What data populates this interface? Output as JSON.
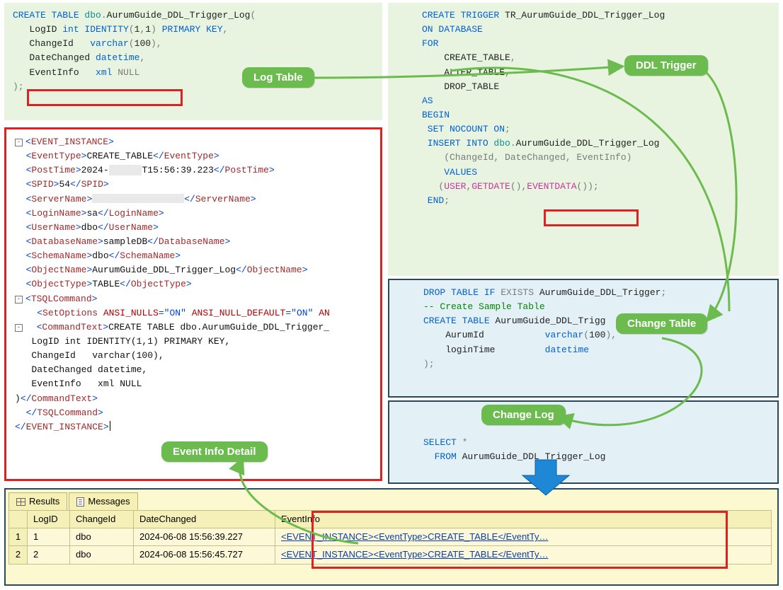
{
  "badges": {
    "log_table": "Log Table",
    "ddl_trigger": "DDL Trigger",
    "event_info_detail": "Event Info Detail",
    "change_table": "Change Table",
    "change_log": "Change Log"
  },
  "log_table_sql": {
    "l1a": "CREATE TABLE ",
    "l1b": "dbo",
    "l1c": ".",
    "l1d": "AurumGuide_DDL_Trigger_Log",
    "l1e": "(",
    "l2a": "   LogID ",
    "l2b": "int IDENTITY",
    "l2c": "(",
    "l2d": "1",
    "l2e": ",",
    "l2f": "1",
    "l2g": ")",
    "l2h": " PRIMARY KEY",
    "l2i": ",",
    "l3a": "   ChangeId   ",
    "l3b": "varchar",
    "l3c": "(",
    "l3d": "100",
    "l3e": "),",
    "l4a": "   DateChanged ",
    "l4b": "datetime",
    "l4c": ",",
    "l5a": "   EventInfo   ",
    "l5b": "xml ",
    "l5c": "NULL",
    "l6": ");"
  },
  "xml": {
    "root_open": "EVENT_INSTANCE",
    "event_type": {
      "tag": "EventType",
      "val": "CREATE_TABLE"
    },
    "post_time": {
      "tag": "PostTime",
      "pre": "2024-",
      "blur": "      ",
      "post": "T15:56:39.223"
    },
    "spid": {
      "tag": "SPID",
      "val": "54"
    },
    "server": {
      "tag": "ServerName",
      "val": ""
    },
    "login": {
      "tag": "LoginName",
      "val": "sa"
    },
    "user": {
      "tag": "UserName",
      "val": "dbo"
    },
    "db": {
      "tag": "DatabaseName",
      "val": "sampleDB"
    },
    "schema": {
      "tag": "SchemaName",
      "val": "dbo"
    },
    "obj": {
      "tag": "ObjectName",
      "val": "AurumGuide_DDL_Trigger_Log"
    },
    "otype": {
      "tag": "ObjectType",
      "val": "TABLE"
    },
    "tsql": "TSQLCommand",
    "setopt_tag": "SetOptions",
    "setopt_a1": "ANSI_NULLS",
    "setopt_v1": "ON",
    "setopt_a2": "ANSI_NULL_DEFAULT",
    "setopt_v2": "ON",
    "setopt_tail": "AN",
    "cmdtext": "CommandText",
    "cmd_l1": "CREATE TABLE dbo.AurumGuide_DDL_Trigger_",
    "cmd_l2": "   LogID int IDENTITY(1,1) PRIMARY KEY,",
    "cmd_l3": "   ChangeId   varchar(100),",
    "cmd_l4": "   DateChanged datetime,",
    "cmd_l5": "   EventInfo   xml NULL",
    "cmd_l6": ")"
  },
  "trigger_sql": {
    "t1a": "CREATE TRIGGER ",
    "t1b": "TR_AurumGuide_DDL_Trigger_Log",
    "t2": "ON DATABASE",
    "t3": "FOR",
    "t4": "    CREATE_TABLE",
    "t4c": ",",
    "t5": "    ALTER_TABLE",
    "t5c": ",",
    "t6": "    DROP_TABLE",
    "t7": "AS",
    "t8": "BEGIN",
    "t9a": " SET NOCOUNT ON",
    "t9b": ";",
    "t10a": " INSERT INTO ",
    "t10b": "dbo",
    "t10c": ".",
    "t10d": "AurumGuide_DDL_Trigger_Log",
    "t11": "    (ChangeId, DateChanged, EventInfo)",
    "t12a": "    VALUES",
    "t13a": "   (",
    "t13b": "USER",
    "t13c": ",",
    "t13d": "GETDATE",
    "t13e": "()",
    "t13f": ",",
    "t13g": "EVENTDATA",
    "t13h": "()",
    "t13i": ");",
    "t14a": " END",
    "t14b": ";"
  },
  "change_table_sql": {
    "c1a": "DROP TABLE IF ",
    "c1b": "EXISTS ",
    "c1c": "AurumGuide_DDL_Trigger",
    "c1d": ";",
    "c2": "-- Create Sample Table",
    "c3a": "CREATE TABLE ",
    "c3b": "AurumGuide_DDL_Trigg",
    "c4a": "    AurumId           ",
    "c4b": "varchar",
    "c4c": "(",
    "c4d": "100",
    "c4e": "),",
    "c5a": "    loginTime         ",
    "c5b": "datetime",
    "c6": ");"
  },
  "select_sql": {
    "s1": "SELECT ",
    "s1b": "*",
    "s2a": "  FROM ",
    "s2b": "AurumGuide_DDL_Trigger_Log"
  },
  "results": {
    "tab_results": "Results",
    "tab_messages": "Messages",
    "cols": [
      "",
      "LogID",
      "ChangeId",
      "DateChanged",
      "EventInfo"
    ],
    "rows": [
      {
        "n": "1",
        "logid": "1",
        "changeid": "dbo",
        "date": "2024-06-08 15:56:39.227",
        "event": "<EVENT_INSTANCE><EventType>CREATE_TABLE</EventTy…"
      },
      {
        "n": "2",
        "logid": "2",
        "changeid": "dbo",
        "date": "2024-06-08 15:56:45.727",
        "event": "<EVENT_INSTANCE><EventType>CREATE_TABLE</EventTy…"
      }
    ]
  }
}
